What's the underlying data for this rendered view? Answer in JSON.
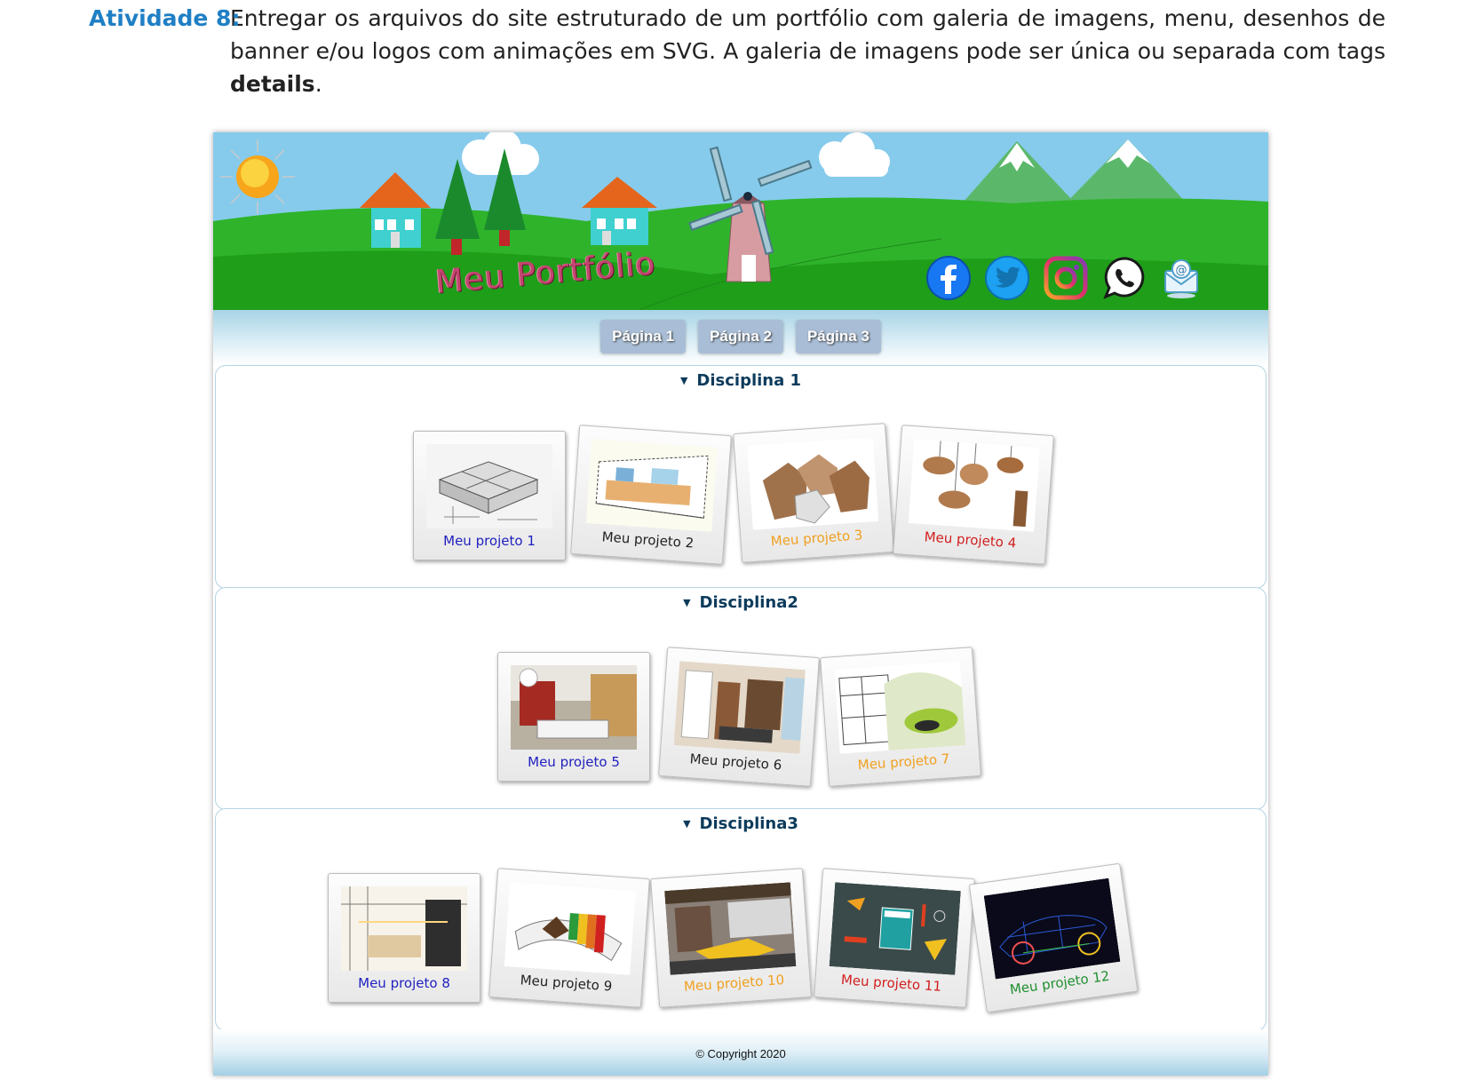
{
  "activity": {
    "label": "Atividade 8:",
    "text_main": "Entregar os arquivos do site estruturado de um portfólio com galeria de imagens, menu, desenhos de banner e/ou logos com animações em SVG. A galeria de imagens pode ser única ou separada com tags ",
    "text_bold": "details",
    "text_end": "."
  },
  "banner": {
    "title": "Meu Portfólio",
    "social_icons": [
      "facebook-icon",
      "twitter-icon",
      "instagram-icon",
      "whatsapp-icon",
      "email-icon"
    ]
  },
  "nav": {
    "items": [
      "Página 1",
      "Página 2",
      "Página 3"
    ]
  },
  "sections": [
    {
      "title": "Disciplina 1",
      "projects": [
        {
          "label": "Meu projeto 1",
          "color": "#1f1fbf"
        },
        {
          "label": "Meu projeto 2",
          "color": "#222222"
        },
        {
          "label": "Meu projeto 3",
          "color": "#f0a020"
        },
        {
          "label": "Meu projeto 4",
          "color": "#d21f1f"
        }
      ]
    },
    {
      "title": "Disciplina2",
      "projects": [
        {
          "label": "Meu projeto 5",
          "color": "#1f1fbf"
        },
        {
          "label": "Meu projeto 6",
          "color": "#222222"
        },
        {
          "label": "Meu projeto 7",
          "color": "#f0a020"
        }
      ]
    },
    {
      "title": "Disciplina3",
      "projects": [
        {
          "label": "Meu projeto 8",
          "color": "#1f1fbf"
        },
        {
          "label": "Meu projeto 9",
          "color": "#222222"
        },
        {
          "label": "Meu projeto 10",
          "color": "#f0a020"
        },
        {
          "label": "Meu projeto 11",
          "color": "#d21f1f"
        },
        {
          "label": "Meu projeto 12",
          "color": "#1f8f2f"
        }
      ]
    }
  ],
  "footer": {
    "copyright": "© Copyright 2020"
  }
}
